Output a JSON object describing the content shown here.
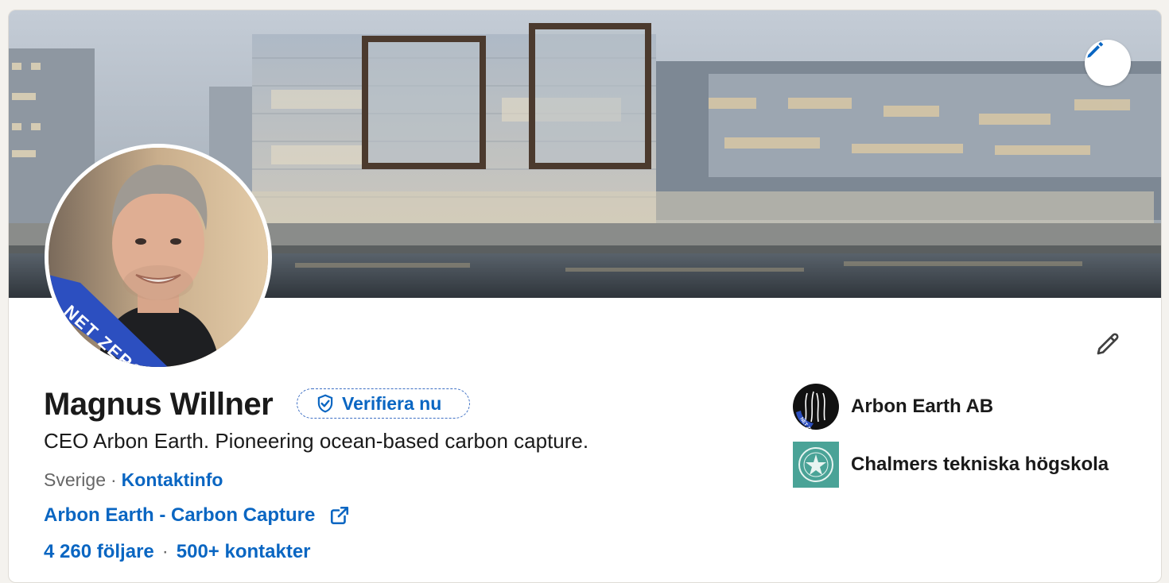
{
  "profile": {
    "name": "Magnus Willner",
    "verify_label": "Verifiera nu",
    "headline": "CEO Arbon Earth. Pioneering ocean-based carbon capture.",
    "location": "Sverige",
    "separator": "·",
    "contact_info_label": "Kontaktinfo",
    "website_label": "Arbon Earth - Carbon Capture",
    "followers_label": "4 260 följare",
    "connections_separator": "·",
    "connections_label": "500+ kontakter",
    "avatar_badge_text": "NET ZERO"
  },
  "organizations": [
    {
      "name": "Arbon Earth AB",
      "logo_icon": "arbon-earth-logo",
      "badge_text": "NET ZERO"
    },
    {
      "name": "Chalmers tekniska högskola",
      "logo_icon": "chalmers-seal-logo"
    }
  ],
  "icons": {
    "cover_edit": "pencil-icon",
    "intro_edit": "pencil-icon",
    "verify": "shield-check-icon",
    "website": "external-link-icon"
  },
  "colors": {
    "link_blue": "#0a66c2",
    "badge_blue": "#2c4fc0",
    "text_primary": "#1a1a1a",
    "text_secondary": "#666666",
    "page_bg": "#f4f2ee",
    "chalmers_green": "#4aa397"
  }
}
